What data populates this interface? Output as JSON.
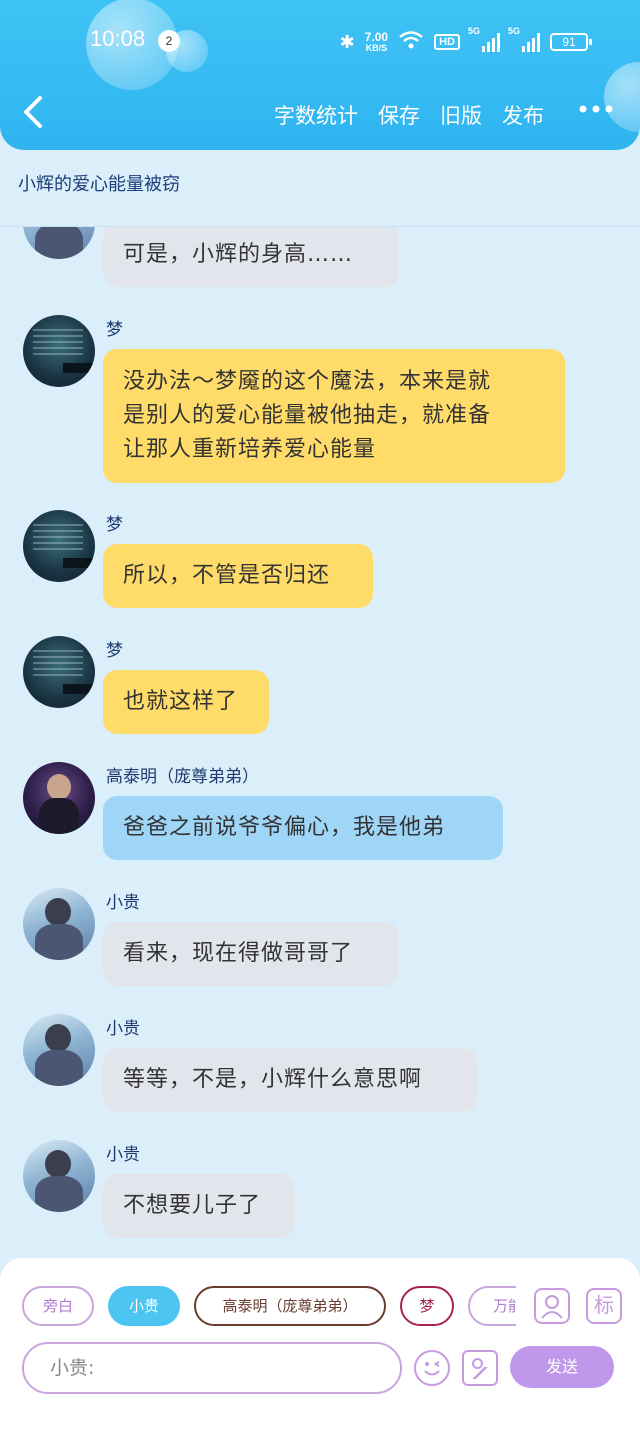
{
  "status_bar": {
    "time": "10:08",
    "notification_count": "2",
    "net_speed_value": "7.00",
    "net_speed_unit": "KB/S",
    "hd_label": "HD",
    "sim1_label": "5G",
    "sim2_label": "5G",
    "battery": "91"
  },
  "header": {
    "back_icon": "chevron-left-icon",
    "actions": [
      "字数统计",
      "保存",
      "旧版",
      "发布"
    ],
    "more_icon": "more-dots-icon"
  },
  "subtitle": "小辉的爱心能量被窃",
  "messages": [
    {
      "name": "",
      "text": "可是，小辉的身高……",
      "color": "gray",
      "avatar": "xiaogui"
    },
    {
      "name": "梦",
      "lines": [
        "没办法～梦魇的这个魔法，本来是就",
        "是别人的爱心能量被他抽走，就准备",
        "让那人重新培养爱心能量"
      ],
      "color": "yellow",
      "avatar": "meng"
    },
    {
      "name": "梦",
      "text": "所以，不管是否归还",
      "color": "yellow",
      "avatar": "meng"
    },
    {
      "name": "梦",
      "text": "也就这样了",
      "color": "yellow",
      "avatar": "meng"
    },
    {
      "name": "高泰明（庞尊弟弟）",
      "text": "爸爸之前说爷爷偏心，我是他弟",
      "color": "blue",
      "avatar": "gao"
    },
    {
      "name": "小贵",
      "text": "看来，现在得做哥哥了",
      "color": "gray",
      "avatar": "xiaogui"
    },
    {
      "name": "小贵",
      "text": "等等，不是，小辉什么意思啊",
      "color": "gray",
      "avatar": "xiaogui"
    },
    {
      "name": "小贵",
      "text": "不想要儿子了",
      "color": "gray",
      "avatar": "xiaogui"
    }
  ],
  "role_chips": [
    "旁白",
    "小贵",
    "高泰明（庞尊弟弟）",
    "梦",
    "万能"
  ],
  "tools": {
    "character_icon": "character-card-icon",
    "mark_label": "标"
  },
  "input": {
    "placeholder": "小贵:"
  },
  "send_label": "发送",
  "colors": {
    "header": "#3fc3f5",
    "bubble_gray": "#e2e6ec",
    "bubble_yellow": "#ffdc6a",
    "bubble_blue": "#9fd5f7",
    "send": "#bf98eb",
    "chip_active": "#4cc5f2"
  }
}
